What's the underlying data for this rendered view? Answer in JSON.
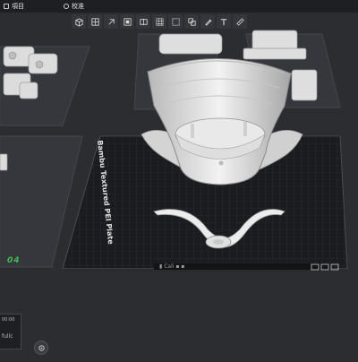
{
  "tabs": [
    {
      "label": "項目",
      "icon": "folder-icon"
    },
    {
      "label": "校准",
      "icon": "calibrate-icon"
    }
  ],
  "plates": {
    "active_plate_brand": "Bambu Textured PEI Plate",
    "left_plate_number": "04",
    "status_text": "▮ Cali ▪ ▪"
  },
  "corner_panel": {
    "line1": "00:00",
    "line2": "fullc"
  },
  "colors": {
    "accent_green": "#3fbf4f",
    "background": "#2b2d31",
    "plate_dark": "#1b1c1f",
    "model_white": "#e8e8e8"
  }
}
